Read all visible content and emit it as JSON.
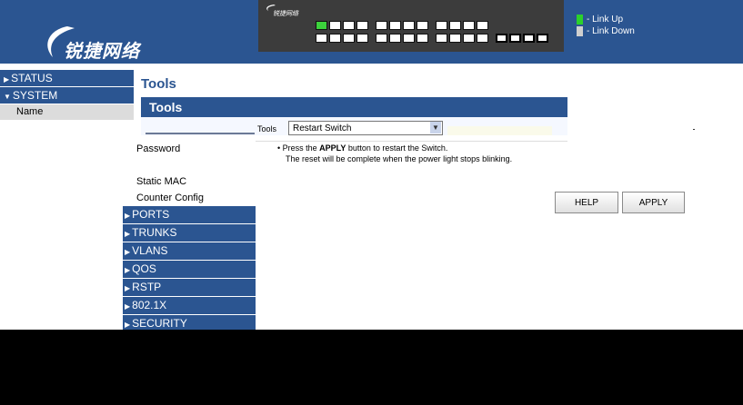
{
  "header": {
    "logo_text": "锐捷网络",
    "switch_brand": "锐捷网络",
    "legend": {
      "link_up": "- Link Up",
      "link_down": "- Link Down"
    },
    "colors": {
      "banner": "#2b5591",
      "link_up": "#2bd12b",
      "link_down": "#cfcfcf"
    }
  },
  "sidebar": {
    "status": "STATUS",
    "system": "SYSTEM",
    "name_item": "Name"
  },
  "page": {
    "title": "Tools",
    "box_title": "Tools",
    "tools_label": "Tools",
    "select_value": "Restart Switch"
  },
  "left_menu": {
    "password": "Password",
    "tools": "• Tools",
    "static_mac": "Static MAC",
    "counter_config": "Counter Config",
    "ports": "PORTS",
    "trunks": "TRUNKS",
    "vlans": "VLANS",
    "qos": "QOS",
    "rstp": "RSTP",
    "dot1x": "802.1X",
    "security": "SECURITY"
  },
  "message": {
    "line1_prefix": "• Press the ",
    "line1_bold": "APPLY",
    "line1_suffix": " button to restart the Switch.",
    "line2": "The reset will be complete when the power light stops blinking."
  },
  "buttons": {
    "help": "HELP",
    "apply": "APPLY"
  }
}
